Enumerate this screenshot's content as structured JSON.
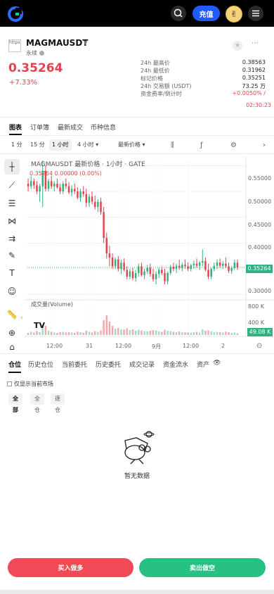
{
  "topbar": {
    "deposit_label": "充值",
    "avatar_emoji": "✌"
  },
  "ticker": {
    "symbol": "MAGMAUSDT",
    "subtag": "永续",
    "broken_image_text": "https",
    "price": "0.35264",
    "change": "+7.33%",
    "stats": [
      {
        "label": "24h 最高价",
        "value": "0.38563"
      },
      {
        "label": "24h 最低价",
        "value": "0.31962"
      },
      {
        "label": "标记价格",
        "value": "0.35251"
      },
      {
        "label": "24h 交易额 (USDT)",
        "value": "73.25 万"
      },
      {
        "label": "资金费率/倒计时",
        "value": "+0.0050% /"
      }
    ],
    "countdown": "02:30:23"
  },
  "main_tabs": [
    "图表",
    "订单簿",
    "最新成交",
    "币种信息"
  ],
  "intervals": {
    "items": [
      "1 分",
      "15 分",
      "1 小时",
      "4 小时 ▾"
    ],
    "active_index": 2,
    "price_type": "最新价格 ▾"
  },
  "chart": {
    "legend_title": "MAGMAUSDT 最新价格 · 1小时 · GATE",
    "legend_ohlc": "0.35264  0.00000 (0.00%)",
    "volume_label": "成交量(Volume)",
    "tv_logo": "TV",
    "last_price_tag": "0.35264",
    "last_volume_tag": "49.08 K",
    "up_color": "#2fb380",
    "down_color": "#e5424c",
    "price_axis": [
      "0.55000",
      "0.50000",
      "0.45000",
      "0.40000",
      "0.35000",
      "0.30000"
    ],
    "volume_axis": [
      "800 K",
      "400 K"
    ],
    "time_axis": [
      "12:00",
      "31",
      "12:00",
      "9月",
      "12:00",
      "2"
    ]
  },
  "chart_data": {
    "type": "candlestick",
    "title": "MAGMAUSDT 最新价格 · 1小时 · GATE",
    "ylim": [
      0.29,
      0.56
    ],
    "volume_ylim": [
      0,
      1000
    ],
    "volume_unit": "K",
    "last_price": 0.35264,
    "last_volume_k": 49.08,
    "x_ticks": [
      "12:00",
      "31",
      "12:00",
      "9月",
      "12:00",
      "2"
    ],
    "candles": [
      [
        0.515,
        0.525,
        0.5,
        0.51,
        60
      ],
      [
        0.51,
        0.53,
        0.505,
        0.52,
        90
      ],
      [
        0.52,
        0.525,
        0.505,
        0.512,
        70
      ],
      [
        0.512,
        0.52,
        0.495,
        0.5,
        110
      ],
      [
        0.5,
        0.515,
        0.48,
        0.51,
        80
      ],
      [
        0.51,
        0.56,
        0.47,
        0.54,
        300
      ],
      [
        0.54,
        0.55,
        0.5,
        0.505,
        260
      ],
      [
        0.505,
        0.525,
        0.5,
        0.52,
        120
      ],
      [
        0.52,
        0.53,
        0.505,
        0.51,
        90
      ],
      [
        0.51,
        0.52,
        0.5,
        0.515,
        70
      ],
      [
        0.515,
        0.525,
        0.505,
        0.508,
        60
      ],
      [
        0.508,
        0.515,
        0.495,
        0.5,
        80
      ],
      [
        0.5,
        0.52,
        0.495,
        0.515,
        90
      ],
      [
        0.515,
        0.525,
        0.505,
        0.51,
        70
      ],
      [
        0.51,
        0.518,
        0.495,
        0.498,
        85
      ],
      [
        0.498,
        0.512,
        0.49,
        0.505,
        75
      ],
      [
        0.505,
        0.515,
        0.495,
        0.5,
        60
      ],
      [
        0.5,
        0.508,
        0.485,
        0.488,
        95
      ],
      [
        0.488,
        0.505,
        0.48,
        0.5,
        80
      ],
      [
        0.5,
        0.51,
        0.49,
        0.495,
        65
      ],
      [
        0.495,
        0.505,
        0.47,
        0.478,
        120
      ],
      [
        0.478,
        0.495,
        0.47,
        0.49,
        90
      ],
      [
        0.49,
        0.5,
        0.475,
        0.48,
        70
      ],
      [
        0.48,
        0.492,
        0.465,
        0.47,
        110
      ],
      [
        0.47,
        0.485,
        0.46,
        0.48,
        90
      ],
      [
        0.48,
        0.488,
        0.455,
        0.46,
        130
      ],
      [
        0.46,
        0.47,
        0.4,
        0.41,
        420
      ],
      [
        0.41,
        0.42,
        0.37,
        0.38,
        560
      ],
      [
        0.38,
        0.395,
        0.355,
        0.372,
        380
      ],
      [
        0.372,
        0.38,
        0.35,
        0.355,
        260
      ],
      [
        0.355,
        0.372,
        0.35,
        0.368,
        180
      ],
      [
        0.368,
        0.375,
        0.345,
        0.35,
        200
      ],
      [
        0.35,
        0.368,
        0.34,
        0.362,
        160
      ],
      [
        0.362,
        0.37,
        0.345,
        0.348,
        150
      ],
      [
        0.348,
        0.355,
        0.33,
        0.335,
        190
      ],
      [
        0.335,
        0.35,
        0.33,
        0.345,
        140
      ],
      [
        0.345,
        0.352,
        0.328,
        0.332,
        160
      ],
      [
        0.332,
        0.348,
        0.325,
        0.342,
        120
      ],
      [
        0.342,
        0.36,
        0.335,
        0.355,
        150
      ],
      [
        0.355,
        0.362,
        0.335,
        0.338,
        130
      ],
      [
        0.338,
        0.35,
        0.33,
        0.345,
        110
      ],
      [
        0.345,
        0.358,
        0.34,
        0.352,
        100
      ],
      [
        0.352,
        0.36,
        0.335,
        0.34,
        120
      ],
      [
        0.34,
        0.35,
        0.325,
        0.33,
        140
      ],
      [
        0.33,
        0.345,
        0.32,
        0.34,
        130
      ],
      [
        0.34,
        0.352,
        0.332,
        0.348,
        100
      ],
      [
        0.348,
        0.355,
        0.338,
        0.342,
        90
      ],
      [
        0.342,
        0.35,
        0.32,
        0.326,
        150
      ],
      [
        0.326,
        0.345,
        0.32,
        0.342,
        120
      ],
      [
        0.342,
        0.358,
        0.338,
        0.354,
        110
      ],
      [
        0.354,
        0.362,
        0.345,
        0.35,
        90
      ],
      [
        0.35,
        0.36,
        0.342,
        0.356,
        85
      ],
      [
        0.356,
        0.368,
        0.348,
        0.352,
        100
      ],
      [
        0.352,
        0.362,
        0.345,
        0.358,
        80
      ],
      [
        0.358,
        0.368,
        0.35,
        0.355,
        75
      ],
      [
        0.355,
        0.362,
        0.346,
        0.35,
        70
      ],
      [
        0.35,
        0.36,
        0.345,
        0.357,
        65
      ],
      [
        0.357,
        0.366,
        0.35,
        0.36,
        80
      ],
      [
        0.36,
        0.37,
        0.352,
        0.356,
        90
      ],
      [
        0.356,
        0.365,
        0.348,
        0.362,
        70
      ],
      [
        0.362,
        0.388,
        0.355,
        0.365,
        160
      ],
      [
        0.365,
        0.372,
        0.345,
        0.348,
        120
      ],
      [
        0.348,
        0.36,
        0.33,
        0.335,
        130
      ],
      [
        0.335,
        0.352,
        0.33,
        0.35,
        100
      ],
      [
        0.35,
        0.362,
        0.345,
        0.356,
        80
      ],
      [
        0.356,
        0.368,
        0.35,
        0.362,
        90
      ],
      [
        0.362,
        0.37,
        0.352,
        0.356,
        85
      ],
      [
        0.356,
        0.365,
        0.35,
        0.36,
        70
      ],
      [
        0.36,
        0.372,
        0.352,
        0.355,
        95
      ],
      [
        0.355,
        0.362,
        0.342,
        0.346,
        80
      ],
      [
        0.346,
        0.356,
        0.34,
        0.352,
        60
      ],
      [
        0.352,
        0.368,
        0.348,
        0.362,
        70
      ],
      [
        0.362,
        0.368,
        0.348,
        0.353,
        49
      ]
    ]
  },
  "position_tabs": [
    "仓位",
    "历史仓位",
    "当前委托",
    "历史委托",
    "成交记录",
    "资金流水",
    "资产"
  ],
  "only_current_label": "仅显示当前市场",
  "filter_chips": [
    "全部",
    "全仓",
    "逐仓"
  ],
  "empty_text": "暂无数据",
  "actions": {
    "buy_label": "买入做多",
    "sell_label": "卖出做空"
  }
}
